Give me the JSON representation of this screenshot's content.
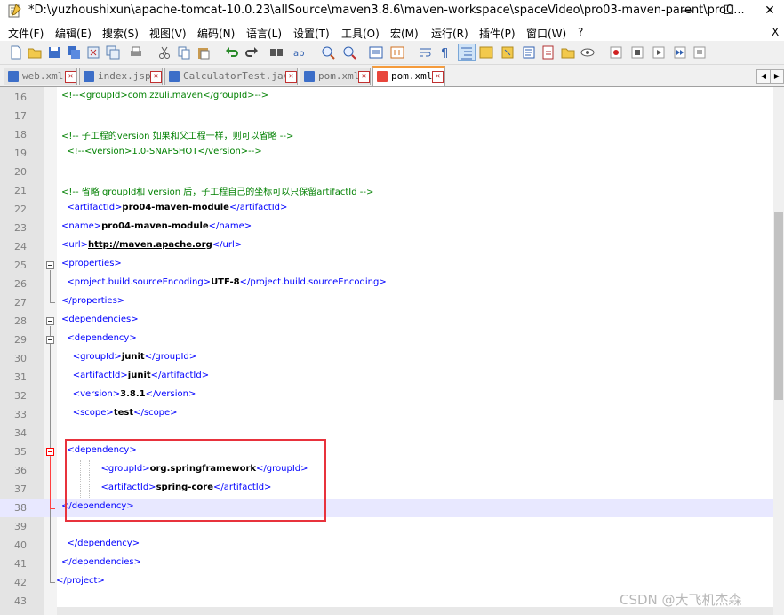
{
  "window": {
    "title": "*D:\\yuzhoushixun\\apache-tomcat-10.0.23\\allSource\\maven3.8.6\\maven-workspace\\spaceVideo\\pro03-maven-parent\\pro0...",
    "minimize": "—",
    "maximize": "☐",
    "close": "✕"
  },
  "menu": {
    "items": [
      "文件(F)",
      "编辑(E)",
      "搜索(S)",
      "视图(V)",
      "编码(N)",
      "语言(L)",
      "设置(T)",
      "工具(O)",
      "宏(M)",
      "运行(R)",
      "插件(P)",
      "窗口(W)",
      "?"
    ],
    "close_x": "X"
  },
  "toolbar": {
    "icons": [
      "new-file-icon",
      "open-file-icon",
      "save-icon",
      "save-all-icon",
      "close-icon",
      "close-all-icon",
      "print-icon",
      "cut-icon",
      "copy-icon",
      "paste-icon",
      "undo-icon",
      "redo-icon",
      "find-icon",
      "replace-icon",
      "zoom-in-icon",
      "zoom-out-icon",
      "sync-v-icon",
      "sync-h-icon",
      "word-wrap-icon",
      "show-all-chars-icon",
      "indent-guide-icon",
      "doc-map-icon",
      "function-list-icon",
      "folder-workspace-icon",
      "monitor-icon",
      "record-macro-icon",
      "stop-macro-icon",
      "play-macro-icon",
      "run-macro-multiple-icon",
      "save-macro-icon"
    ]
  },
  "tabs": [
    {
      "label": "web.xml",
      "active": false
    },
    {
      "label": "index.jsp",
      "active": false
    },
    {
      "label": "CalculatorTest.java",
      "active": false
    },
    {
      "label": "pom.xml",
      "active": false
    },
    {
      "label": "pom.xml",
      "active": true
    }
  ],
  "tab_scroll": {
    "left": "◀",
    "right": "▶"
  },
  "editor": {
    "current_line": 38,
    "lines": [
      {
        "n": "16",
        "segs": [
          {
            "c": "cm",
            "t": "<!--<groupId>com.zzuli.maven</groupId>-->"
          }
        ]
      },
      {
        "n": "17",
        "segs": []
      },
      {
        "n": "18",
        "segs": [
          {
            "c": "cm",
            "t": "<!-- 子工程的version 如果和父工程一样，则可以省略 -->"
          }
        ]
      },
      {
        "n": "19",
        "segs": [
          {
            "c": "cm",
            "t": "  <!--<version>1.0-SNAPSHOT</version>-->"
          }
        ]
      },
      {
        "n": "20",
        "segs": []
      },
      {
        "n": "21",
        "segs": [
          {
            "c": "cm",
            "t": "<!-- 省略 groupId和 version 后，子工程自己的坐标可以只保留artifactId -->"
          }
        ]
      },
      {
        "n": "22",
        "segs": [
          {
            "c": "tg",
            "t": "  <artifactId>"
          },
          {
            "c": "tx",
            "t": "pro04-maven-module"
          },
          {
            "c": "tg",
            "t": "</artifactId>"
          }
        ]
      },
      {
        "n": "23",
        "segs": [
          {
            "c": "tg",
            "t": "<name>"
          },
          {
            "c": "tx",
            "t": "pro04-maven-module"
          },
          {
            "c": "tg",
            "t": "</name>"
          }
        ]
      },
      {
        "n": "24",
        "segs": [
          {
            "c": "tg",
            "t": "<url>"
          },
          {
            "c": "lk",
            "t": "http://maven.apache.org"
          },
          {
            "c": "tg",
            "t": "</url>"
          }
        ]
      },
      {
        "n": "25",
        "segs": [
          {
            "c": "tg",
            "t": "<properties>"
          }
        ]
      },
      {
        "n": "26",
        "segs": [
          {
            "c": "tg",
            "t": "  <project.build.sourceEncoding>"
          },
          {
            "c": "tx",
            "t": "UTF-8"
          },
          {
            "c": "tg",
            "t": "</project.build.sourceEncoding>"
          }
        ]
      },
      {
        "n": "27",
        "segs": [
          {
            "c": "tg",
            "t": "</properties>"
          }
        ]
      },
      {
        "n": "28",
        "segs": [
          {
            "c": "tg",
            "t": "<dependencies>"
          }
        ]
      },
      {
        "n": "29",
        "segs": [
          {
            "c": "tg",
            "t": "  <dependency>"
          }
        ]
      },
      {
        "n": "30",
        "segs": [
          {
            "c": "tg",
            "t": "    <groupId>"
          },
          {
            "c": "tx",
            "t": "junit"
          },
          {
            "c": "tg",
            "t": "</groupId>"
          }
        ]
      },
      {
        "n": "31",
        "segs": [
          {
            "c": "tg",
            "t": "    <artifactId>"
          },
          {
            "c": "tx",
            "t": "junit"
          },
          {
            "c": "tg",
            "t": "</artifactId>"
          }
        ]
      },
      {
        "n": "32",
        "segs": [
          {
            "c": "tg",
            "t": "    <version>"
          },
          {
            "c": "tx",
            "t": "3.8.1"
          },
          {
            "c": "tg",
            "t": "</version>"
          }
        ]
      },
      {
        "n": "33",
        "segs": [
          {
            "c": "tg",
            "t": "    <scope>"
          },
          {
            "c": "tx",
            "t": "test"
          },
          {
            "c": "tg",
            "t": "</scope>"
          }
        ]
      },
      {
        "n": "34",
        "segs": []
      },
      {
        "n": "35",
        "segs": [
          {
            "c": "tg",
            "t": "  <dependency>"
          }
        ]
      },
      {
        "n": "36",
        "segs": [
          {
            "c": "tg",
            "t": "              <groupId>"
          },
          {
            "c": "tx",
            "t": "org.springframework"
          },
          {
            "c": "tg",
            "t": "</groupId>"
          }
        ]
      },
      {
        "n": "37",
        "segs": [
          {
            "c": "tg",
            "t": "              <artifactId>"
          },
          {
            "c": "tx",
            "t": "spring-core"
          },
          {
            "c": "tg",
            "t": "</artifactId>"
          }
        ]
      },
      {
        "n": "38",
        "segs": [
          {
            "c": "tg",
            "t": "</dependency>"
          }
        ]
      },
      {
        "n": "39",
        "segs": []
      },
      {
        "n": "40",
        "segs": [
          {
            "c": "tg",
            "t": "  </dependency>"
          }
        ]
      },
      {
        "n": "41",
        "segs": [
          {
            "c": "tg",
            "t": "</dependencies>"
          }
        ]
      },
      {
        "n": "42",
        "segs": [
          {
            "c": "tg",
            "t": "</project>"
          }
        ]
      },
      {
        "n": "43",
        "segs": []
      }
    ]
  },
  "watermark": "CSDN @大飞机杰森"
}
